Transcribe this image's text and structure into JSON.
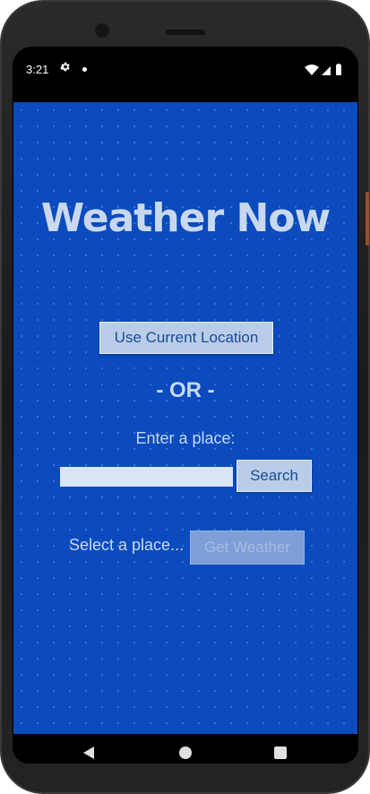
{
  "status_bar": {
    "time": "3:21",
    "icons": [
      "settings-gear-icon",
      "notification-dot-icon",
      "wifi-icon",
      "signal-icon",
      "battery-icon"
    ]
  },
  "app": {
    "title": "Weather Now",
    "use_location_label": "Use Current Location",
    "or_text": "- OR -",
    "enter_place_label": "Enter a place:",
    "search_input_value": "",
    "search_label": "Search",
    "select_place_label": "Select a place...",
    "get_weather_label": "Get Weather",
    "get_weather_enabled": false
  },
  "nav_bar": {
    "icons": [
      "back-icon",
      "home-icon",
      "recents-icon"
    ]
  },
  "colors": {
    "background": "#0b4bbd",
    "title_text": "#c8d8ef",
    "button_bg": "#b9cde9",
    "button_text": "#1c4a96",
    "disabled_button_bg": "#7d9fd6"
  }
}
